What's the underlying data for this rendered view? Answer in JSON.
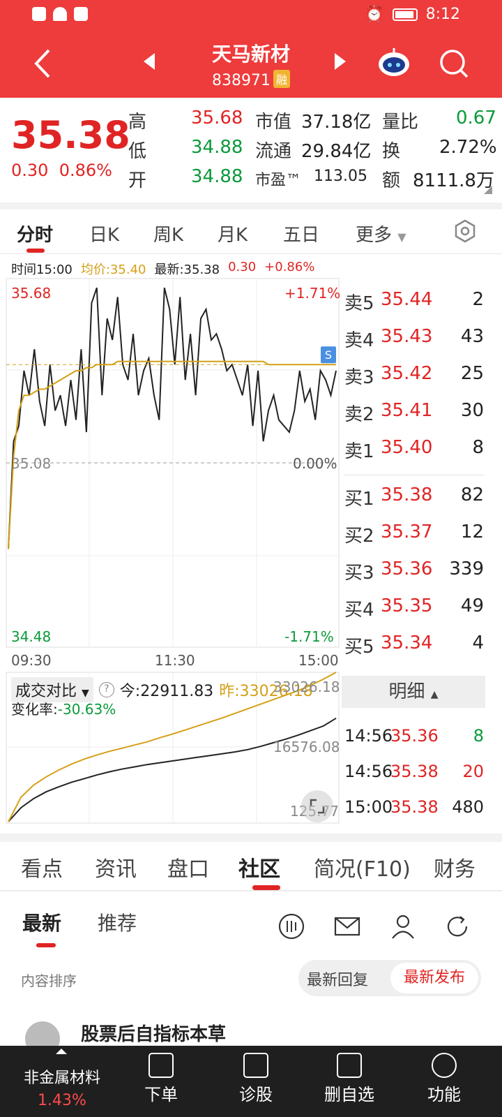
{
  "status": {
    "time": "8:12"
  },
  "header": {
    "name": "天马新材",
    "code": "838971",
    "badge": "融"
  },
  "quote": {
    "price": "35.38",
    "change": "0.30",
    "change_pct": "0.86%",
    "high_label": "高",
    "high": "35.68",
    "low_label": "低",
    "low": "34.88",
    "open_label": "开",
    "open": "34.88",
    "mcap_label": "市值",
    "mcap": "37.18亿",
    "float_label": "流通",
    "float": "29.84亿",
    "pe_label": "市盈™",
    "pe": "113.05",
    "vr_label": "量比",
    "vr": "0.67",
    "turnover_label": "换",
    "turnover": "2.72%",
    "amount_label": "额",
    "amount": "8111.8万"
  },
  "ktabs": [
    "分时",
    "日K",
    "周K",
    "月K",
    "五日",
    "更多"
  ],
  "infoline": {
    "time": "时间15:00",
    "avg": "均价:35.40",
    "last": "最新:35.38",
    "chg": "0.30",
    "pct": "+0.86%"
  },
  "chart_data": [
    {
      "type": "line",
      "title": "",
      "xlabel": "",
      "ylabel": "",
      "x_ticks": [
        "09:30",
        "11:30",
        "15:00"
      ],
      "ylim": [
        34.48,
        35.68
      ],
      "y_labels": {
        "top": "35.68",
        "mid": "35.08",
        "bottom": "34.48",
        "top_pct": "+1.71%",
        "mid_pct": "0.00%",
        "bottom_pct": "-1.71%"
      },
      "prev_close": 35.08,
      "marker": "S",
      "series": [
        {
          "values": [
            34.8,
            35.15,
            35.2,
            35.38,
            35.3,
            35.45,
            35.28,
            35.2,
            35.4,
            35.25,
            35.3,
            35.2,
            35.35,
            35.22,
            35.45,
            35.18,
            35.6,
            35.65,
            35.3,
            35.55,
            35.48,
            35.62,
            35.4,
            35.35,
            35.5,
            35.3,
            35.38,
            35.42,
            35.3,
            35.22,
            35.65,
            35.58,
            35.4,
            35.62,
            35.35,
            35.5,
            35.3,
            35.55,
            35.58,
            35.48,
            35.5,
            35.45,
            35.38,
            35.4,
            35.35,
            35.3,
            35.4,
            35.2,
            35.38,
            35.15,
            35.25,
            35.3,
            35.22,
            35.2,
            35.18,
            35.25,
            35.38,
            35.28,
            35.32,
            35.22,
            35.38,
            35.35,
            35.3,
            35.38
          ]
        },
        {
          "values": [
            34.8,
            35.1,
            35.25,
            35.3,
            35.3,
            35.31,
            35.32,
            35.32,
            35.33,
            35.34,
            35.35,
            35.36,
            35.37,
            35.38,
            35.38,
            35.39,
            35.39,
            35.4,
            35.4,
            35.4,
            35.4,
            35.41,
            35.41,
            35.41,
            35.41,
            35.41,
            35.41,
            35.41,
            35.41,
            35.41,
            35.41,
            35.41,
            35.41,
            35.41,
            35.41,
            35.41,
            35.41,
            35.41,
            35.41,
            35.41,
            35.41,
            35.41,
            35.41,
            35.41,
            35.41,
            35.41,
            35.41,
            35.41,
            35.41,
            35.41,
            35.4,
            35.4,
            35.4,
            35.4,
            35.4,
            35.4,
            35.4,
            35.4,
            35.4,
            35.4,
            35.4,
            35.4,
            35.4,
            35.4
          ]
        }
      ]
    },
    {
      "type": "line",
      "title": "",
      "xlabel": "",
      "ylabel": "",
      "ylim": [
        125.77,
        33026.18
      ],
      "y_labels": {
        "top": "33026.18",
        "mid": "16576.08",
        "bottom": "125.77"
      },
      "series": [
        {
          "name": "今",
          "values": [
            125.77,
            3200,
            5200,
            6700,
            7800,
            8800,
            9600,
            10400,
            11100,
            11700,
            12200,
            12700,
            13100,
            13500,
            13900,
            14300,
            14700,
            15100,
            15500,
            16000,
            16700,
            17500,
            18300,
            19200,
            20200,
            21200,
            22911.83
          ]
        },
        {
          "name": "昨",
          "values": [
            125.77,
            5500,
            8200,
            10000,
            11500,
            12800,
            13900,
            14800,
            15600,
            16300,
            17000,
            17700,
            18600,
            19400,
            20300,
            21200,
            22100,
            23000,
            24000,
            25000,
            26000,
            27000,
            28000,
            29000,
            30200,
            31500,
            33026.18
          ]
        }
      ]
    }
  ],
  "orderbook": {
    "asks": [
      {
        "label": "卖5",
        "price": "35.44",
        "vol": "2"
      },
      {
        "label": "卖4",
        "price": "35.43",
        "vol": "43"
      },
      {
        "label": "卖3",
        "price": "35.42",
        "vol": "25"
      },
      {
        "label": "卖2",
        "price": "35.41",
        "vol": "30"
      },
      {
        "label": "卖1",
        "price": "35.40",
        "vol": "8"
      }
    ],
    "bids": [
      {
        "label": "买1",
        "price": "35.38",
        "vol": "82"
      },
      {
        "label": "买2",
        "price": "35.37",
        "vol": "12"
      },
      {
        "label": "买3",
        "price": "35.36",
        "vol": "339"
      },
      {
        "label": "买4",
        "price": "35.35",
        "vol": "49"
      },
      {
        "label": "买5",
        "price": "35.34",
        "vol": "4"
      }
    ],
    "detail_label": "明细",
    "ticks": [
      {
        "time": "14:56",
        "price": "35.36",
        "vol": "8"
      },
      {
        "time": "14:56",
        "price": "35.38",
        "vol": "20"
      },
      {
        "time": "15:00",
        "price": "35.38",
        "vol": "480"
      }
    ]
  },
  "volume": {
    "title": "成交对比",
    "help": "?",
    "today": "今:22911.83",
    "yest": "昨:33026.18",
    "rate_label": "变化率:",
    "rate": "-30.63%"
  },
  "ctabs": [
    "看点",
    "资讯",
    "盘口",
    "社区",
    "简况(F10)",
    "财务"
  ],
  "community": {
    "subtabs": [
      "最新",
      "推荐"
    ],
    "sort_label": "内容排序",
    "sort_reply": "最新回复",
    "sort_publish": "最新发布",
    "post_title": "股票后自指标本草"
  },
  "bottomnav": {
    "sector_name": "非金属材料",
    "sector_chg": "1.43%",
    "buttons": [
      "下单",
      "诊股",
      "删自选",
      "功能"
    ]
  }
}
